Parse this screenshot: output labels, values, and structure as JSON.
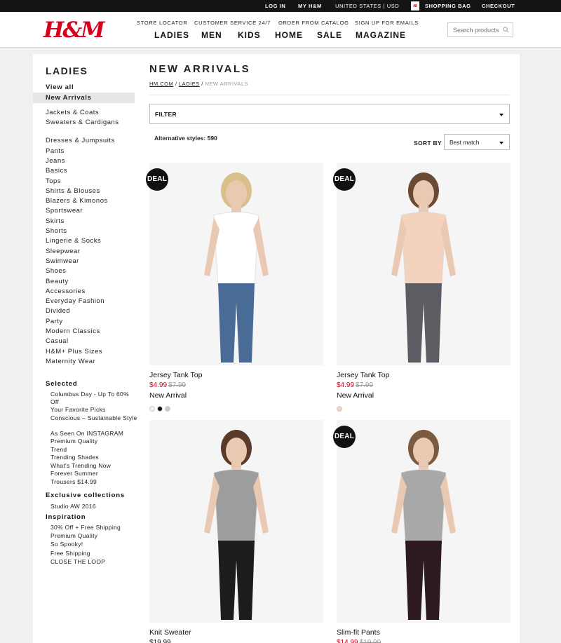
{
  "topbar": {
    "login": "LOG IN",
    "my_hm": "MY H&M",
    "region": "UNITED STATES | USD",
    "bag_count": "48",
    "shopping_bag": "SHOPPING BAG",
    "checkout": "CHECKOUT"
  },
  "header": {
    "logo": "H&M",
    "sublinks": [
      "STORE LOCATOR",
      "CUSTOMER SERVICE 24/7",
      "ORDER FROM CATALOG",
      "SIGN UP FOR EMAILS"
    ],
    "nav": [
      "LADIES",
      "MEN",
      "KIDS",
      "HOME",
      "SALE",
      "MAGAZINE"
    ],
    "search_placeholder": "Search products"
  },
  "sidebar": {
    "title": "LADIES",
    "view_all": "View all",
    "active": "New Arrivals",
    "categories": [
      "Jackets & Coats",
      "Sweaters & Cardigans",
      "Dresses & Jumpsuits",
      "Pants",
      "Jeans",
      "Basics",
      "Tops",
      "Shirts & Blouses",
      "Blazers & Kimonos",
      "Sportswear",
      "Skirts",
      "Shorts",
      "Lingerie & Socks",
      "Sleepwear",
      "Swimwear",
      "Shoes",
      "Beauty",
      "Accessories",
      "Everyday Fashion",
      "Divided",
      "Party",
      "Modern Classics",
      "Casual",
      "H&M+ Plus Sizes",
      "Maternity Wear"
    ],
    "selected_title": "Selected",
    "selected": [
      "Columbus Day - Up To 60% Off",
      "Your Favorite Picks",
      "Conscious – Sustainable Style",
      "As Seen On INSTAGRAM",
      "Premium Quality",
      "Trend",
      "Trending Shades",
      "What's Trending Now",
      "Forever Summer",
      "Trousers $14.99"
    ],
    "exclusive_title": "Exclusive collections",
    "exclusive": [
      "Studio AW 2016"
    ],
    "inspiration_title": "Inspiration",
    "inspiration": [
      "30% Off + Free Shipping",
      "Premium Quality",
      "So Spooky!",
      "Free Shipping",
      "CLOSE THE LOOP"
    ]
  },
  "main": {
    "title": "NEW ARRIVALS",
    "breadcrumb": {
      "home": "HM.COM",
      "sep": " / ",
      "ladies": "LADIES",
      "current": "NEW ARRIVALS"
    },
    "filter_label": "FILTER",
    "alt_styles": "Alternative styles: 590",
    "sort_label": "SORT BY",
    "sort_value": "Best match"
  },
  "products": [
    {
      "deal": "DEAL",
      "name": "Jersey Tank Top",
      "price": "$4.99",
      "was": "$7.99",
      "badge": "New Arrival",
      "swatches": [
        "#f2f2f2",
        "#111111",
        "#c8c8c8"
      ],
      "top": "#ffffff",
      "bottom": "#4a6b95",
      "hair": "#d8c08a"
    },
    {
      "deal": "DEAL",
      "name": "Jersey Tank Top",
      "price": "$4.99",
      "was": "$7.99",
      "badge": "New Arrival",
      "swatches": [
        "#efd3c3"
      ],
      "top": "#f3d3bd",
      "bottom": "#5b5d63",
      "hair": "#6b4a35"
    },
    {
      "deal": "",
      "name": "Knit Sweater",
      "price": "$19.99",
      "was": "",
      "badge": "",
      "swatches": [],
      "top": "#9d9d9d",
      "bottom": "#1c1c1c",
      "hair": "#5a3a28"
    },
    {
      "deal": "DEAL",
      "name": "Slim-fit Pants",
      "price": "$14.99",
      "was": "$19.99",
      "badge": "",
      "swatches": [],
      "top": "#a8a8a8",
      "bottom": "#2e1a22",
      "hair": "#7a5a40"
    }
  ]
}
